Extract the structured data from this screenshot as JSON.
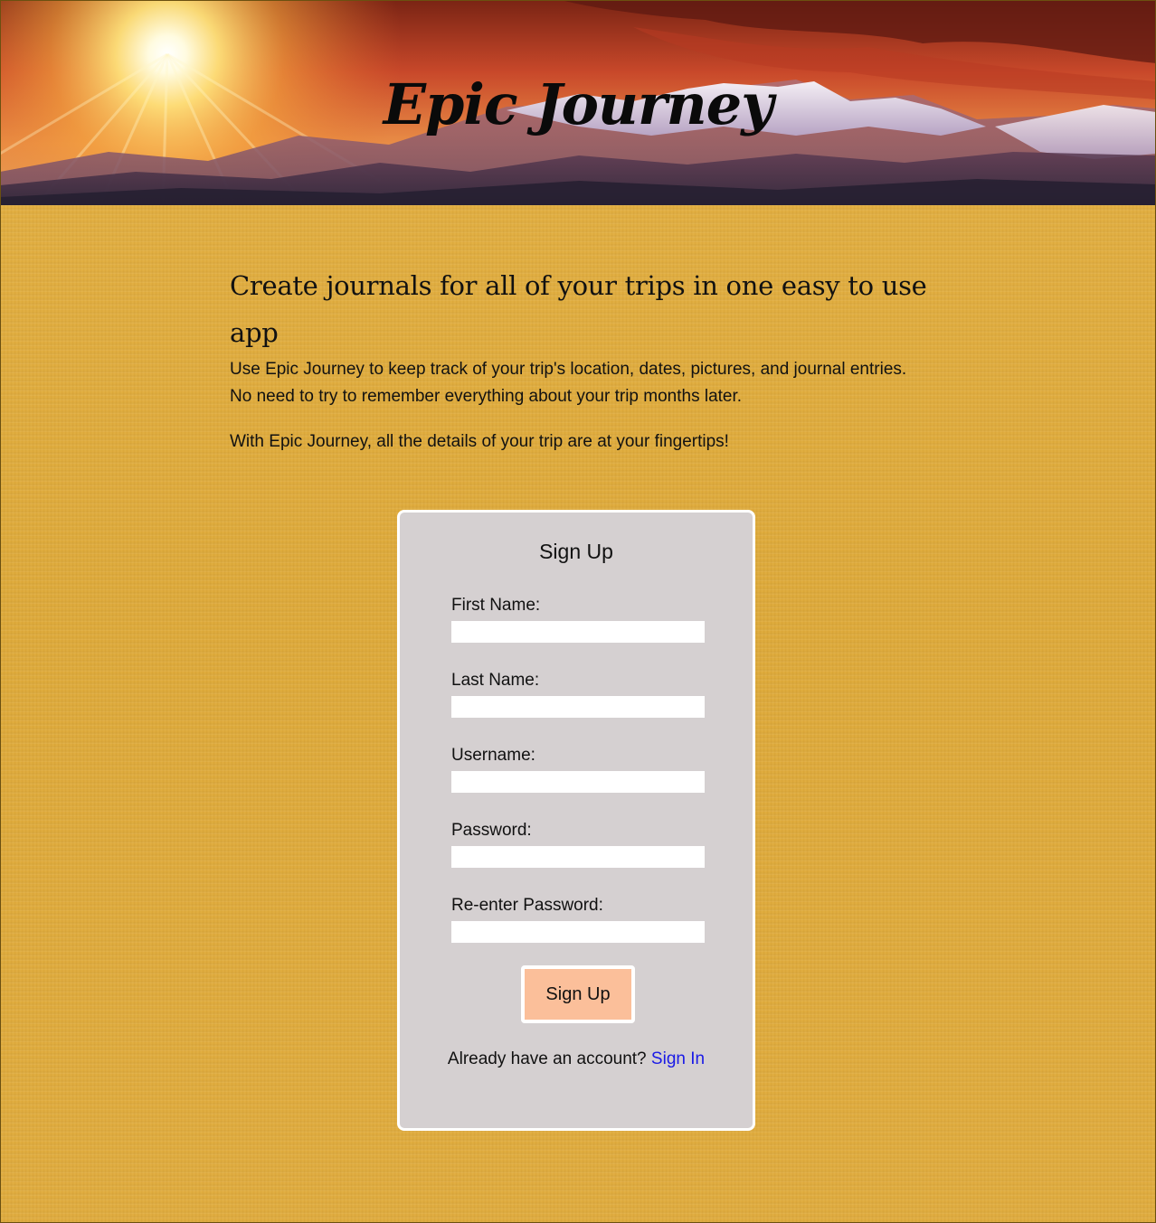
{
  "header": {
    "title": "Epic Journey"
  },
  "intro": {
    "headline": "Create journals for all of your trips in one easy to use app",
    "paragraph_1_line_1": "Use Epic Journey to keep track of your trip's location, dates, pictures, and journal entries.",
    "paragraph_1_line_2": "No need to try to remember everything about your trip months later.",
    "paragraph_2": "With Epic Journey, all the details of your trip are at your fingertips!"
  },
  "signup_form": {
    "title": "Sign Up",
    "fields": [
      {
        "label": "First Name:",
        "value": ""
      },
      {
        "label": "Last Name:",
        "value": ""
      },
      {
        "label": "Username:",
        "value": ""
      },
      {
        "label": "Password:",
        "value": ""
      },
      {
        "label": "Re-enter Password:",
        "value": ""
      }
    ],
    "submit_label": "Sign Up",
    "signin_prompt": "Already have an account?",
    "signin_link": "Sign In"
  },
  "colors": {
    "page_background": "#e0ac3c",
    "card_background": "#d5d0d1",
    "button_background": "#fbbf9a",
    "link": "#1a1ae6"
  }
}
